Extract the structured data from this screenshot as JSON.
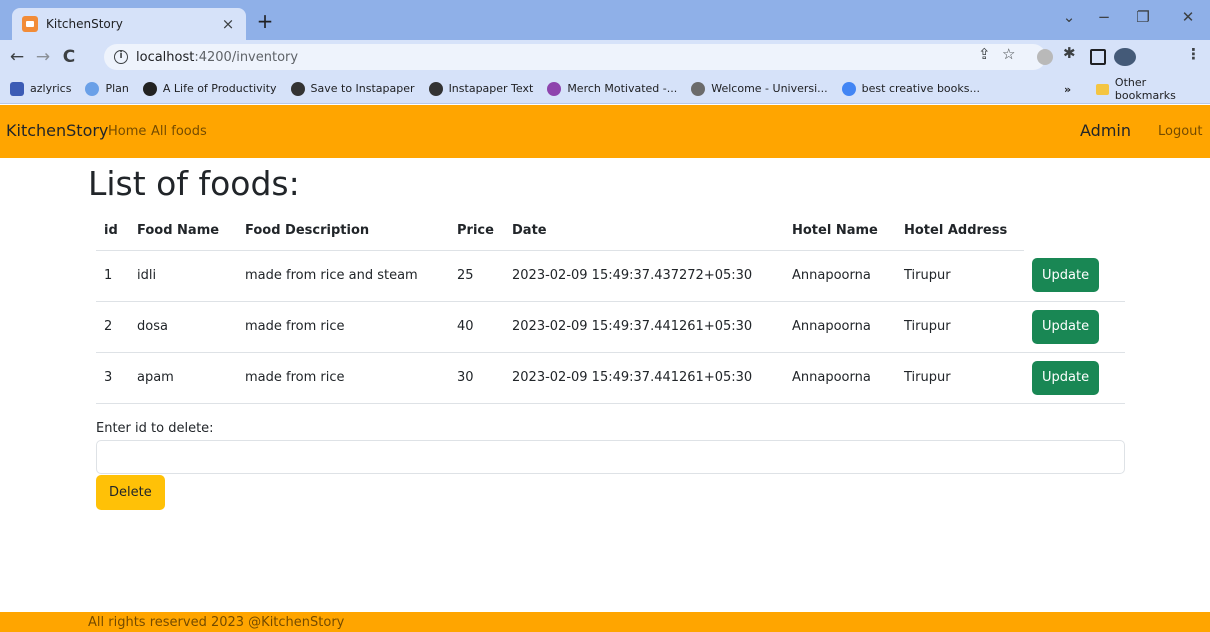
{
  "browser": {
    "tab_title": "KitchenStory",
    "tab_close": "×",
    "new_tab": "+",
    "window_controls": {
      "minimize": "−",
      "restore": "❐",
      "close": "✕",
      "dropdown": "⌄"
    },
    "url_host": "localhost",
    "url_path": ":4200/inventory",
    "bookmarks": [
      {
        "label": "azlyrics",
        "icon": "azlyrics-icon",
        "color": "#3b5bb5"
      },
      {
        "label": "Plan",
        "icon": "plan-icon",
        "color": "#6aa0e8"
      },
      {
        "label": "A Life of Productivity",
        "icon": "productivity-icon",
        "color": "#222222"
      },
      {
        "label": "Save to Instapaper",
        "icon": "instapaper-icon",
        "color": "#333333"
      },
      {
        "label": "Instapaper Text",
        "icon": "instapaper-text-icon",
        "color": "#333333"
      },
      {
        "label": "Merch Motivated -...",
        "icon": "merch-icon",
        "color": "#8e44ad"
      },
      {
        "label": "Welcome - Universi...",
        "icon": "university-icon",
        "color": "#6b6b6b"
      },
      {
        "label": "best creative books...",
        "icon": "google-icon",
        "color": "#4285f4"
      }
    ],
    "bookmarks_overflow": "»",
    "other_bookmarks": "Other bookmarks"
  },
  "navbar": {
    "brand": "KitchenStory",
    "links": [
      "Home",
      "All foods"
    ],
    "admin": "Admin",
    "logout": "Logout"
  },
  "main": {
    "title": "List of foods:",
    "columns": [
      "id",
      "Food Name",
      "Food Description",
      "Price",
      "Date",
      "Hotel Name",
      "Hotel Address"
    ],
    "rows": [
      {
        "id": "1",
        "name": "idli",
        "description": "made from rice and steam",
        "price": "25",
        "date": "2023-02-09 15:49:37.437272+05:30",
        "hotel": "Annapoorna",
        "address": "Tirupur",
        "action": "Update"
      },
      {
        "id": "2",
        "name": "dosa",
        "description": "made from rice",
        "price": "40",
        "date": "2023-02-09 15:49:37.441261+05:30",
        "hotel": "Annapoorna",
        "address": "Tirupur",
        "action": "Update"
      },
      {
        "id": "3",
        "name": "apam",
        "description": "made from rice",
        "price": "30",
        "date": "2023-02-09 15:49:37.441261+05:30",
        "hotel": "Annapoorna",
        "address": "Tirupur",
        "action": "Update"
      }
    ],
    "delete_label": "Enter id to delete:",
    "delete_value": "",
    "delete_button": "Delete"
  },
  "footer": {
    "text": "All rights reserved 2023 @KitchenStory"
  },
  "colors": {
    "navbar": "#ffa500",
    "update_button": "#198754",
    "delete_button": "#ffc107"
  }
}
